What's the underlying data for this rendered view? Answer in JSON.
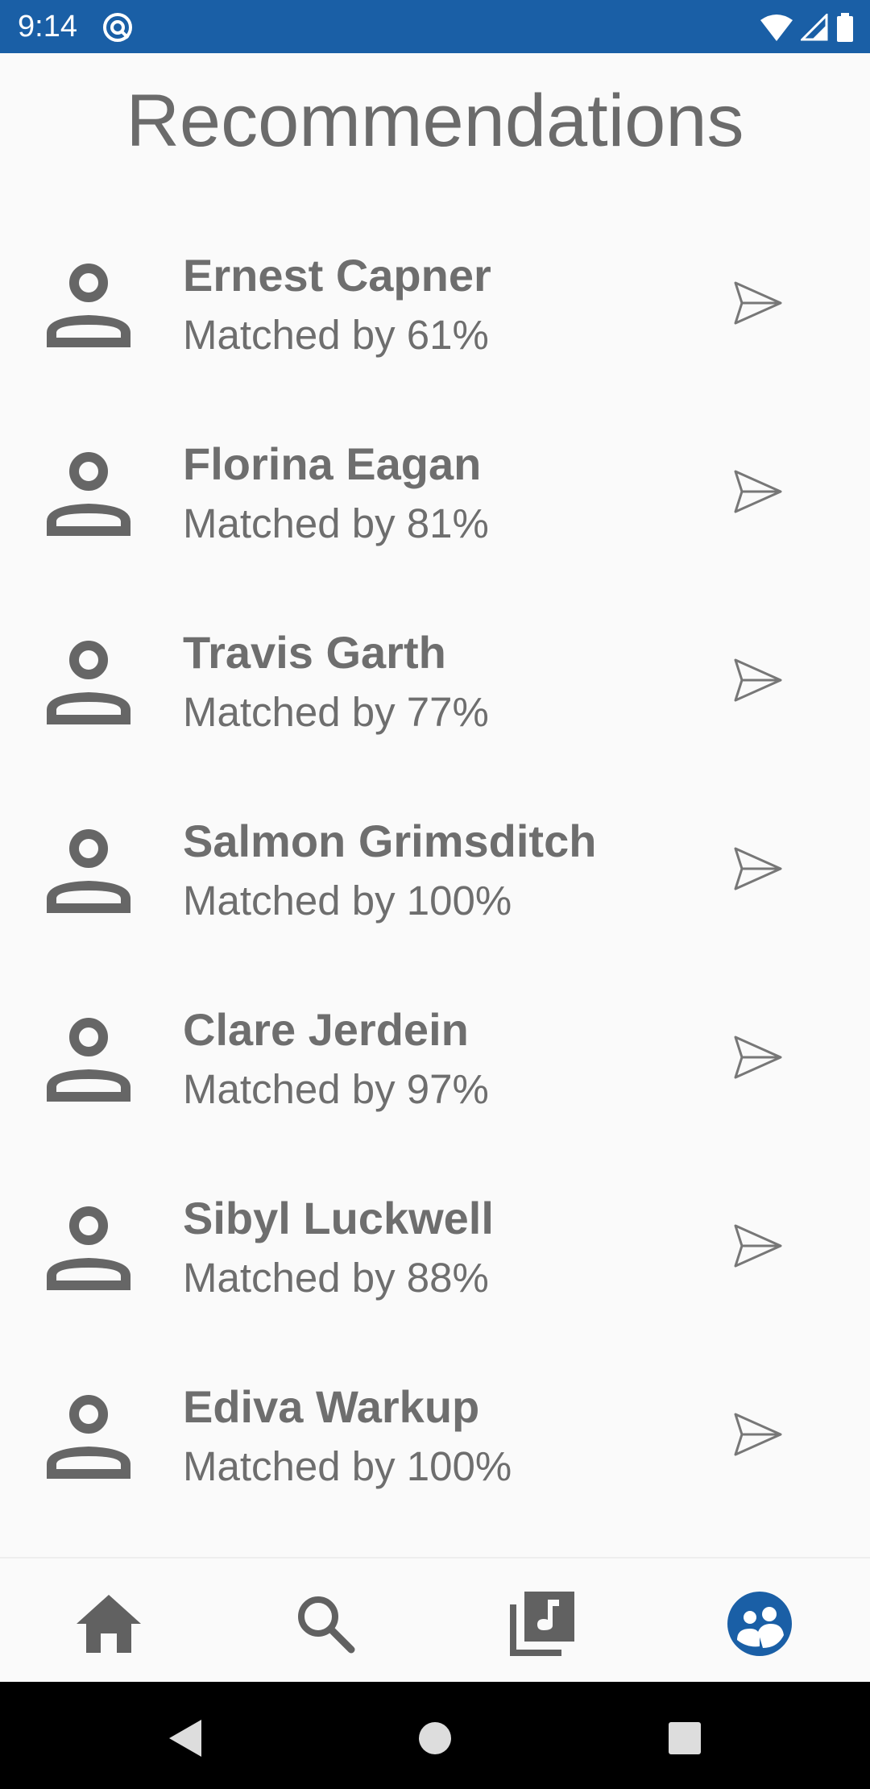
{
  "status_bar": {
    "time": "9:14",
    "app_icon": "at-sign-icon",
    "icons": [
      "wifi-icon",
      "cell-signal-icon",
      "battery-icon"
    ]
  },
  "header": {
    "title": "Recommendations"
  },
  "recommendations": [
    {
      "name": "Ernest Capner",
      "match": "Matched by 61%"
    },
    {
      "name": "Florina Eagan",
      "match": "Matched by 81%"
    },
    {
      "name": "Travis Garth",
      "match": "Matched by 77%"
    },
    {
      "name": "Salmon Grimsditch",
      "match": "Matched by 100%"
    },
    {
      "name": "Clare Jerdein",
      "match": "Matched by 97%"
    },
    {
      "name": "Sibyl Luckwell",
      "match": "Matched by 88%"
    },
    {
      "name": "Ediva Warkup",
      "match": "Matched by 100%"
    }
  ],
  "bottom_nav": {
    "items": [
      {
        "icon": "home-icon",
        "active": false
      },
      {
        "icon": "search-icon",
        "active": false
      },
      {
        "icon": "music-library-icon",
        "active": false
      },
      {
        "icon": "recommendations-people-icon",
        "active": true
      }
    ]
  },
  "system_nav": {
    "items": [
      "back-icon",
      "home-circle-icon",
      "recents-square-icon"
    ]
  },
  "colors": {
    "status_bar": "#1a5fa6",
    "accent": "#1a5fa6",
    "text_primary": "#6e6e6e",
    "icon_inactive": "#616161",
    "background": "#fafafa"
  }
}
